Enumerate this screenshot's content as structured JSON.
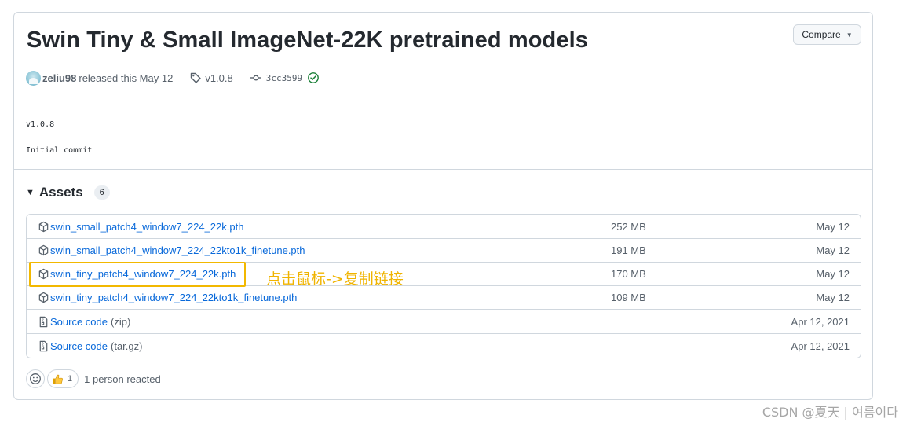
{
  "release": {
    "title": "Swin Tiny & Small ImageNet-22K pretrained models",
    "compare_label": "Compare",
    "author": "zeliu98",
    "released_text": "released this May 12",
    "tag": "v1.0.8",
    "commit": "3cc3599",
    "body_lines": [
      "v1.0.8",
      "Initial commit"
    ]
  },
  "assets": {
    "title": "Assets",
    "count": "6",
    "items": [
      {
        "name": "swin_small_patch4_window7_224_22k.pth",
        "size": "252 MB",
        "date": "May 12",
        "icon": "package-icon"
      },
      {
        "name": "swin_small_patch4_window7_224_22kto1k_finetune.pth",
        "size": "191 MB",
        "date": "May 12",
        "icon": "package-icon"
      },
      {
        "name": "swin_tiny_patch4_window7_224_22k.pth",
        "size": "170 MB",
        "date": "May 12",
        "icon": "package-icon"
      },
      {
        "name": "swin_tiny_patch4_window7_224_22kto1k_finetune.pth",
        "size": "109 MB",
        "date": "May 12",
        "icon": "package-icon"
      },
      {
        "name": "Source code",
        "suffix": "(zip)",
        "size": "",
        "date": "Apr 12, 2021",
        "icon": "file-zip-icon"
      },
      {
        "name": "Source code",
        "suffix": "(tar.gz)",
        "size": "",
        "date": "Apr 12, 2021",
        "icon": "file-zip-icon"
      }
    ]
  },
  "reactions": {
    "thumbs_up_count": "1",
    "summary": "1 person reacted"
  },
  "annotation": {
    "text": "点击鼠标->复制链接",
    "color": "#f0b400"
  },
  "watermark": "CSDN @夏天 | 여름이다",
  "colors": {
    "link": "#0969da",
    "muted": "#57606a",
    "border": "#d0d7de",
    "success": "#1a7f37",
    "highlight": "#f2b800"
  }
}
